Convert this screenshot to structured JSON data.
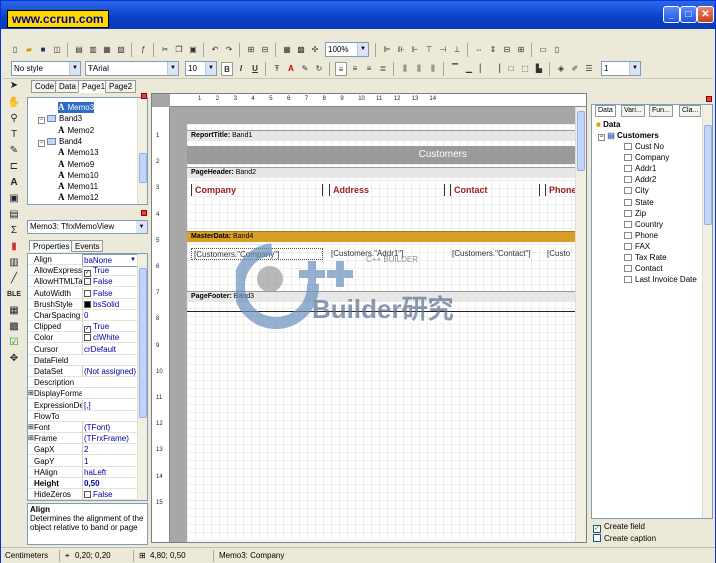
{
  "window": {
    "logo": "www.ccrun.com",
    "min": "_",
    "max": "□",
    "close": "✕"
  },
  "toolbar1": {
    "zoom": "100%"
  },
  "toolbar2": {
    "style_combo": "No style",
    "font_combo": "Arial",
    "size_combo": "10",
    "bold": "B",
    "italic": "I",
    "underline": "U",
    "linewidth_combo": "1"
  },
  "page_tabs": [
    "Code",
    "Data",
    "Page1",
    "Page2"
  ],
  "tree": [
    {
      "label": "Memo3",
      "kind": "memo",
      "indent": 3
    },
    {
      "label": "Band3",
      "kind": "band",
      "indent": 1
    },
    {
      "label": "Memo2",
      "kind": "memo",
      "indent": 3
    },
    {
      "label": "Band4",
      "kind": "band",
      "indent": 1
    },
    {
      "label": "Memo13",
      "kind": "memo",
      "indent": 3
    },
    {
      "label": "Memo9",
      "kind": "memo",
      "indent": 3
    },
    {
      "label": "Memo10",
      "kind": "memo",
      "indent": 3
    },
    {
      "label": "Memo11",
      "kind": "memo",
      "indent": 3
    },
    {
      "label": "Memo12",
      "kind": "memo",
      "indent": 3
    }
  ],
  "object_combo": "Memo3: TfrxMemoView",
  "inspector_tabs": [
    "Properties",
    "Events"
  ],
  "properties": [
    {
      "name": "Align",
      "value": "baNone"
    },
    {
      "name": "AllowExpressio",
      "value": "True",
      "check": true
    },
    {
      "name": "AllowHTMLTag",
      "value": "False",
      "check": false
    },
    {
      "name": "AutoWidth",
      "value": "False",
      "check": false
    },
    {
      "name": "BrushStyle",
      "value": "bsSolid",
      "swatch": "#000000"
    },
    {
      "name": "CharSpacing",
      "value": "0"
    },
    {
      "name": "Clipped",
      "value": "True",
      "check": true
    },
    {
      "name": "Color",
      "value": "clWhite",
      "swatch": "#ffffff"
    },
    {
      "name": "Cursor",
      "value": "crDefault"
    },
    {
      "name": "DataField",
      "value": ""
    },
    {
      "name": "DataSet",
      "value": "(Not assigned)"
    },
    {
      "name": "Description",
      "value": ""
    },
    {
      "name": "DisplayFormat",
      "value": "",
      "expand": true
    },
    {
      "name": "ExpressionDel",
      "value": "[,]"
    },
    {
      "name": "FlowTo",
      "value": ""
    },
    {
      "name": "Font",
      "value": "(TFont)",
      "expand": true
    },
    {
      "name": "Frame",
      "value": "(TFrxFrame)",
      "expand": true
    },
    {
      "name": "GapX",
      "value": "2"
    },
    {
      "name": "GapY",
      "value": "1"
    },
    {
      "name": "HAlign",
      "value": "haLeft"
    },
    {
      "name": "Height",
      "value": "0,50",
      "bold": true
    },
    {
      "name": "HideZeros",
      "value": "False",
      "check": false
    }
  ],
  "help": {
    "title": "Align",
    "text": "Determines the alignment of the object relative to band or page"
  },
  "ruler": {
    "h": [
      "1",
      "2",
      "3",
      "4",
      "5",
      "6",
      "7",
      "8",
      "9",
      "10",
      "11",
      "12",
      "13",
      "14"
    ],
    "v": [
      "1",
      "2",
      "3",
      "4",
      "5",
      "6",
      "7",
      "8",
      "9",
      "10",
      "11",
      "12",
      "13",
      "14",
      "15"
    ]
  },
  "report": {
    "bands": {
      "title": "ReportTitle:",
      "title_name": "Band1",
      "header": "PageHeader:",
      "header_name": "Band2",
      "master": "MasterData:",
      "master_name": "Band4",
      "footer": "PageFooter:",
      "footer_name": "Band3"
    },
    "title_text": "Customers",
    "headers": [
      "Company",
      "Address",
      "Contact",
      "Phone"
    ],
    "master_cells": [
      "[Customers.\"Company\"]",
      "[Customers.\"Addr1\"]",
      "[Customers.\"Contact\"]",
      "[Custo"
    ],
    "watermark_text": "Builder研究",
    "watermark_sub": "C++ BUILDER"
  },
  "right_tabs": [
    "Data",
    "Vari...",
    "Fun...",
    "Cla..."
  ],
  "data_tree": {
    "root": "Data",
    "dataset": "Customers",
    "fields": [
      "Cust No",
      "Company",
      "Addr1",
      "Addr2",
      "City",
      "State",
      "Zip",
      "Country",
      "Phone",
      "FAX",
      "Tax Rate",
      "Contact",
      "Last Invoice Date"
    ]
  },
  "right_checks": [
    {
      "label": "Create field",
      "checked": true
    },
    {
      "label": "Create caption",
      "checked": false
    }
  ],
  "status": {
    "units": "Centimeters",
    "pos1": "0,20; 0,20",
    "pos2": "4,80; 0,50",
    "object": "Memo3: Company"
  }
}
